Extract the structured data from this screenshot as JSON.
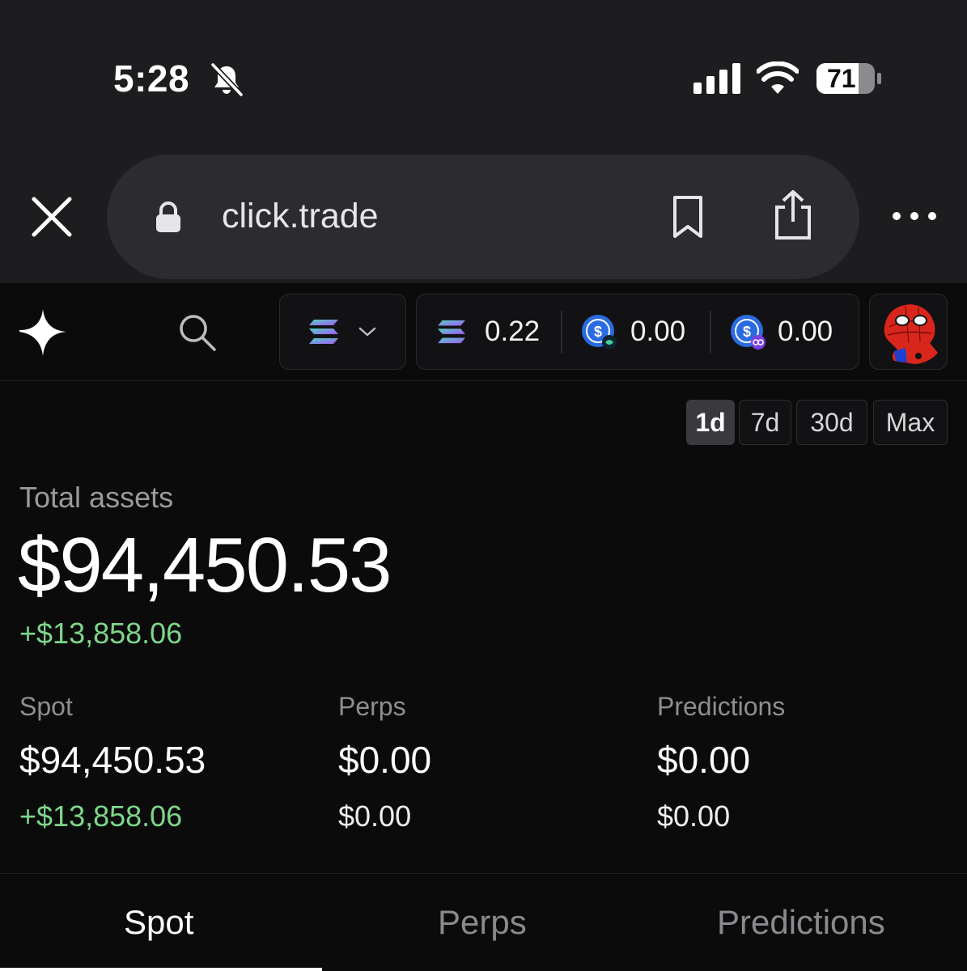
{
  "status_bar": {
    "time": "5:28",
    "battery": "71"
  },
  "browser": {
    "url": "click.trade"
  },
  "header": {
    "chain_icon": "solana-icon",
    "balances": [
      {
        "icon": "solana-icon",
        "value": "0.22"
      },
      {
        "icon": "usdc-icon",
        "value": "0.00"
      },
      {
        "icon": "usdc-bridged-icon",
        "value": "0.00"
      }
    ]
  },
  "ranges": {
    "items": [
      "1d",
      "7d",
      "30d",
      "Max"
    ],
    "selected": "1d"
  },
  "portfolio": {
    "label": "Total assets",
    "total": "$94,450.53",
    "change": "+$13,858.06",
    "categories": [
      {
        "label": "Spot",
        "value": "$94,450.53",
        "change": "+$13,858.06"
      },
      {
        "label": "Perps",
        "value": "$0.00",
        "change": "$0.00"
      },
      {
        "label": "Predictions",
        "value": "$0.00",
        "change": "$0.00"
      }
    ]
  },
  "tabs": {
    "items": [
      "Spot",
      "Perps",
      "Predictions"
    ],
    "selected": "Spot"
  },
  "colors": {
    "positive": "#7ed68a",
    "background": "#0b0b0c",
    "chrome": "#1d1d20"
  }
}
